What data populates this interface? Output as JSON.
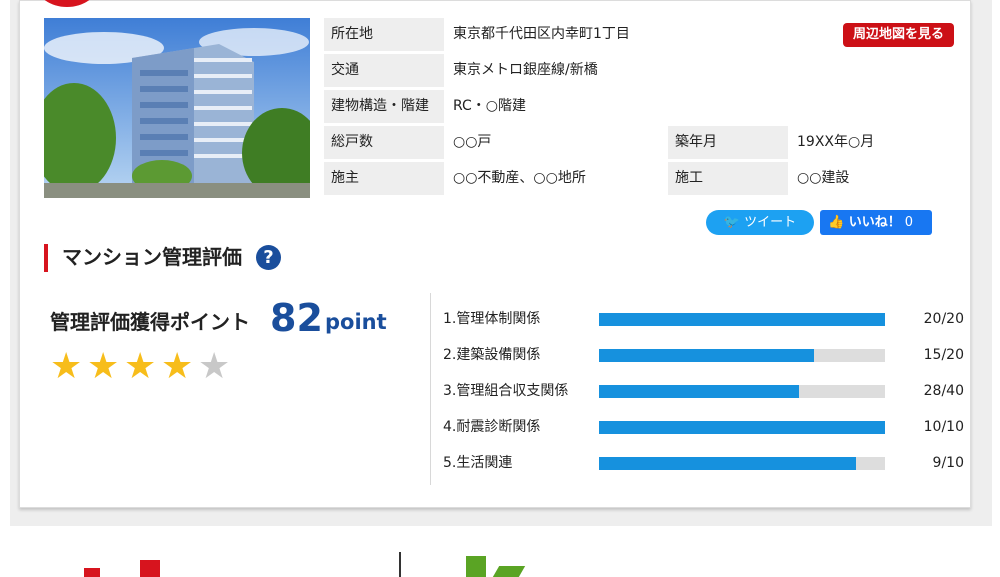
{
  "property": {
    "rows": [
      {
        "label": "所在地",
        "value": "東京都千代田区内幸町1丁目"
      },
      {
        "label": "交通",
        "value": "東京メトロ銀座線/新橋"
      },
      {
        "label": "建物構造・階建",
        "value": "RC・○階建"
      },
      {
        "label": "総戸数",
        "value": "○○戸",
        "label2": "築年月",
        "value2": "19XX年○月"
      },
      {
        "label": "施主",
        "value": "○○不動産、○○地所",
        "label2": "施工",
        "value2": "○○建設"
      }
    ],
    "map_button_label": "周辺地図を見る"
  },
  "social": {
    "tweet_label": "ツイート",
    "like_label": "いいね！",
    "like_count": "0"
  },
  "evaluation": {
    "section_title": "マンション管理評価",
    "help_icon": "?",
    "points_label": "管理評価獲得ポイント",
    "points_value": "82",
    "points_unit": "point",
    "rating_stars": 4,
    "rating_max": 5,
    "metrics": [
      {
        "label": "1.管理体制関係",
        "score": "20/20",
        "fraction": 1.0
      },
      {
        "label": "2.建築設備関係",
        "score": "15/20",
        "fraction": 0.75
      },
      {
        "label": "3.管理組合収支関係",
        "score": "28/40",
        "fraction": 0.7
      },
      {
        "label": "4.耐震診断関係",
        "score": "10/10",
        "fraction": 1.0
      },
      {
        "label": "5.生活関連",
        "score": "9/10",
        "fraction": 0.9
      }
    ]
  },
  "colors": {
    "accent_red": "#d7141e",
    "brand_blue": "#1a4e9c",
    "bar_blue": "#1691de",
    "star_gold": "#f7bd1b",
    "star_gray": "#c8c8c8"
  }
}
